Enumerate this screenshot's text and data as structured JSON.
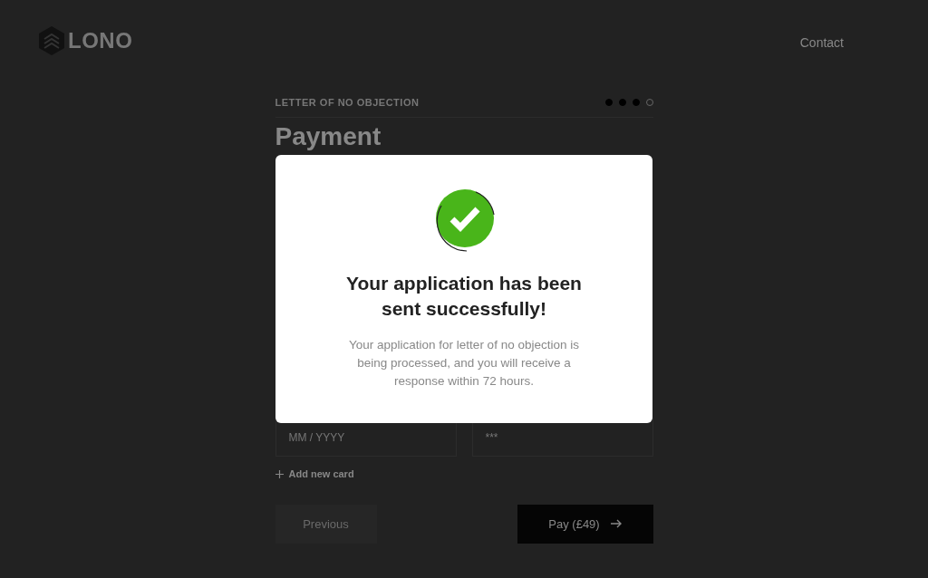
{
  "header": {
    "logo": "LONO",
    "nav": [
      "Contact"
    ]
  },
  "form": {
    "step_label": "LETTER OF NO OBJECTION",
    "steps": [
      {
        "done": true
      },
      {
        "done": true
      },
      {
        "done": true
      },
      {
        "done": false
      }
    ],
    "title": "Payment",
    "fields": [
      {
        "placeholder": "MM / YYYY"
      },
      {
        "placeholder": "***"
      }
    ],
    "add_card": "Add new card",
    "previous": {
      "label": "Previous",
      "disabled": true
    },
    "pay": {
      "label": "Pay (£49)"
    }
  },
  "modal": {
    "title": "Your application has been sent successfully!",
    "message": "Your application for letter of no objection is being processed, and you will receive a response within 72 hours."
  }
}
